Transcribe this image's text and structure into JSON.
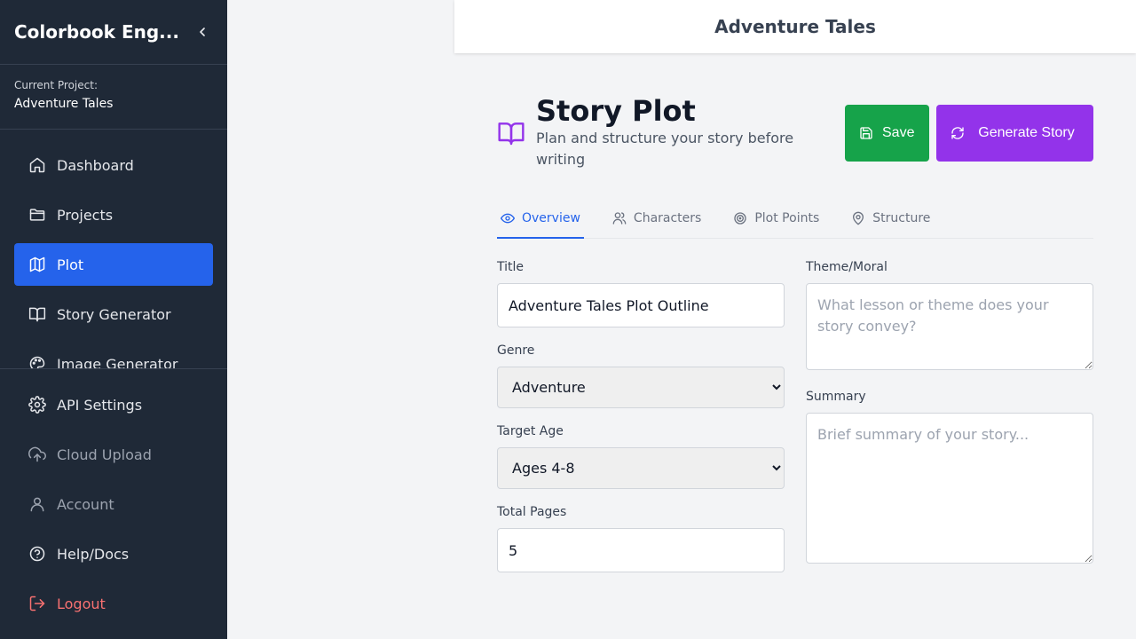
{
  "sidebar": {
    "brand": "Colorbook Eng...",
    "project_label": "Current Project:",
    "project_name": "Adventure Tales",
    "main_items": [
      {
        "label": "Dashboard",
        "icon": "home-icon"
      },
      {
        "label": "Projects",
        "icon": "folder-icon"
      },
      {
        "label": "Plot",
        "icon": "map-icon"
      },
      {
        "label": "Story Generator",
        "icon": "book-open-icon"
      },
      {
        "label": "Image Generator",
        "icon": "palette-icon"
      }
    ],
    "bottom_items": [
      {
        "label": "API Settings",
        "icon": "gear-icon"
      },
      {
        "label": "Cloud Upload",
        "icon": "cloud-upload-icon"
      },
      {
        "label": "Account",
        "icon": "user-icon"
      },
      {
        "label": "Help/Docs",
        "icon": "help-circle-icon"
      },
      {
        "label": "Logout",
        "icon": "logout-icon"
      }
    ],
    "active_item": "Plot"
  },
  "header": {
    "title": "Adventure Tales"
  },
  "page": {
    "title": "Story Plot",
    "subtitle": "Plan and structure your story before writing",
    "save_label": "Save",
    "generate_label": "Generate Story"
  },
  "tabs": [
    {
      "label": "Overview",
      "icon": "eye-icon",
      "active": true
    },
    {
      "label": "Characters",
      "icon": "users-icon",
      "active": false
    },
    {
      "label": "Plot Points",
      "icon": "target-icon",
      "active": false
    },
    {
      "label": "Structure",
      "icon": "map-pin-icon",
      "active": false
    }
  ],
  "form": {
    "title_label": "Title",
    "title_value": "Adventure Tales Plot Outline",
    "genre_label": "Genre",
    "genre_value": "Adventure",
    "age_label": "Target Age",
    "age_value": "Ages 4-8",
    "pages_label": "Total Pages",
    "pages_value": "5",
    "theme_label": "Theme/Moral",
    "theme_placeholder": "What lesson or theme does your story convey?",
    "summary_label": "Summary",
    "summary_placeholder": "Brief summary of your story..."
  },
  "colors": {
    "sidebar_bg": "#1f2937",
    "active_blue": "#2563eb",
    "save_green": "#16a34a",
    "generate_purple": "#9333ea",
    "logout_red": "#f87171"
  }
}
